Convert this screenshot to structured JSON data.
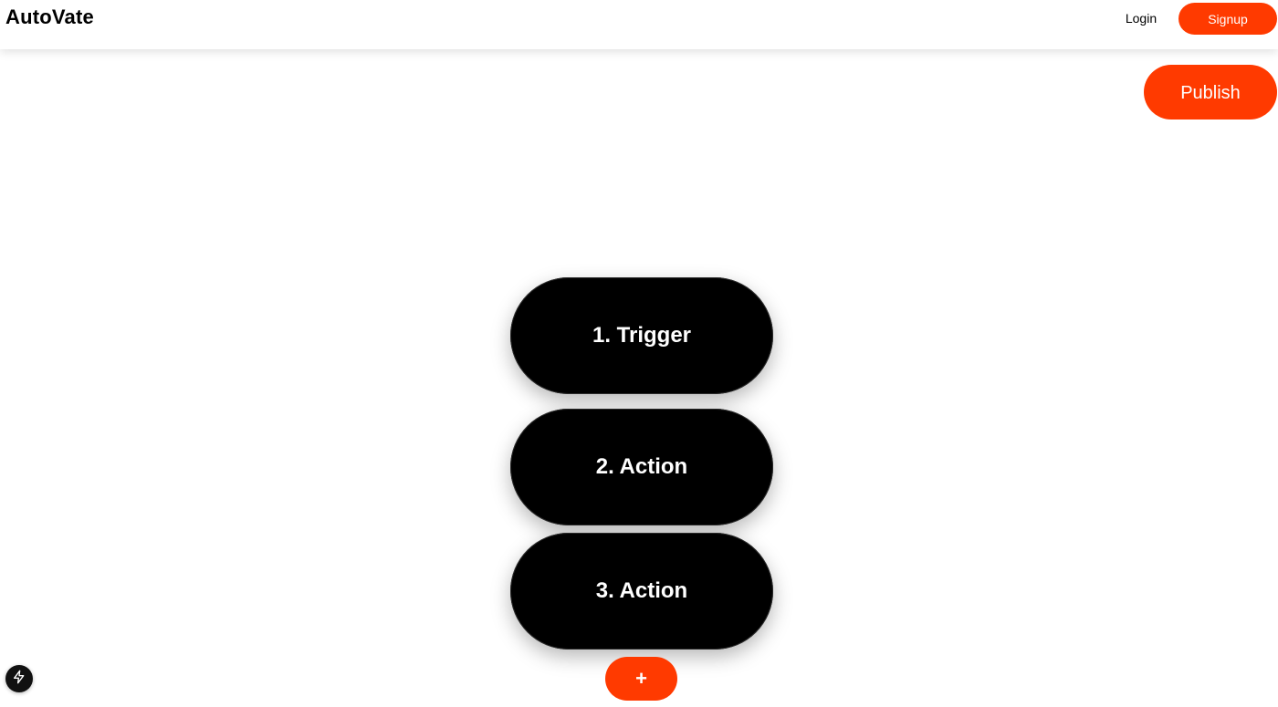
{
  "header": {
    "brand": "AutoVate",
    "login_label": "Login",
    "signup_label": "Signup"
  },
  "toolbar": {
    "publish_label": "Publish"
  },
  "workflow": {
    "steps": [
      {
        "label": "1. Trigger"
      },
      {
        "label": "2. Action"
      },
      {
        "label": "3. Action"
      }
    ],
    "add_label": "+"
  },
  "dev_indicator": {
    "icon": "lightning-icon"
  },
  "colors": {
    "accent": "#ff3a00",
    "step_bg": "#000000",
    "text_light": "#ffffff"
  }
}
